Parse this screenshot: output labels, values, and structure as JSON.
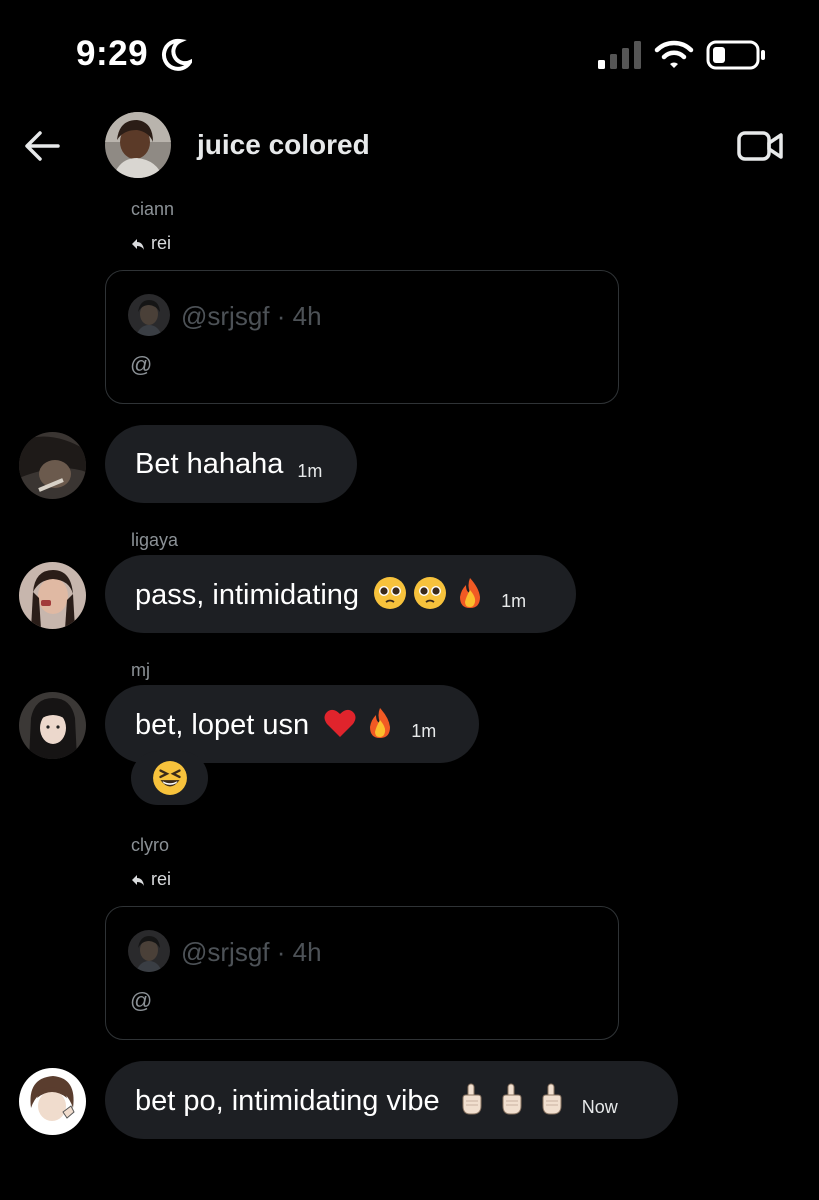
{
  "status_bar": {
    "time": "9:29"
  },
  "header": {
    "title": "juice colored"
  },
  "messages": [
    {
      "sender": "ciann",
      "reply_to": "rei",
      "quote": {
        "handle": "@srjsgf · 4h",
        "text": "@"
      }
    },
    {
      "text": "Bet hahaha",
      "time": "1m"
    },
    {
      "sender": "ligaya",
      "text": "pass, intimidating",
      "time": "1m",
      "emojis": [
        "pleading-face",
        "pleading-face",
        "fire"
      ]
    },
    {
      "sender": "mj",
      "text": "bet, lopet usn",
      "time": "1m",
      "emojis": [
        "red-heart",
        "fire"
      ],
      "reaction": "grinning-squinting-face"
    },
    {
      "sender": "clyro",
      "reply_to": "rei",
      "quote": {
        "handle": "@srjsgf · 4h",
        "text": "@"
      }
    },
    {
      "text": "bet po, intimidating vibe",
      "time": "Now",
      "emojis": [
        "index-pointing-up",
        "index-pointing-up",
        "index-pointing-up"
      ]
    }
  ],
  "colors": {
    "background": "#000000",
    "bubble": "#1d1f23",
    "secondary_text": "#8b9196",
    "quote_border": "#2f3336"
  }
}
